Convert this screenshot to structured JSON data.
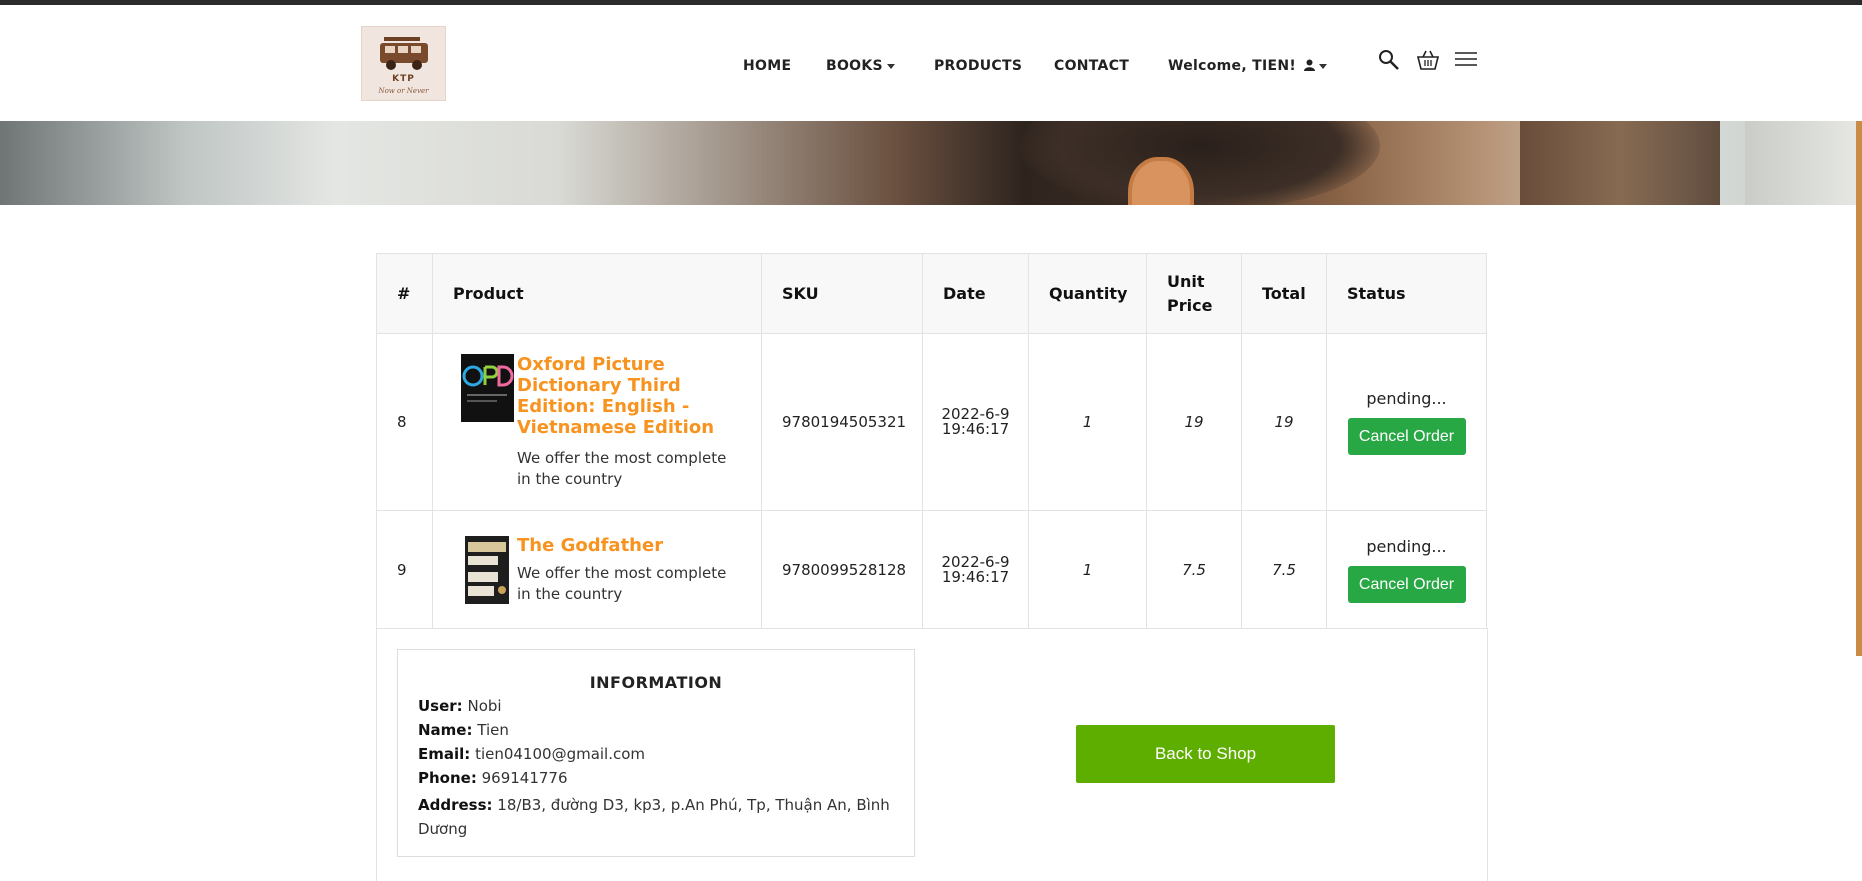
{
  "brand": {
    "logo_title": "KTP",
    "logo_subtitle": "Now or Never"
  },
  "nav": {
    "home": "HOME",
    "books": "BOOKS",
    "products": "PRODUCTS",
    "contact": "CONTACT",
    "welcome": "Welcome, TIEN!",
    "icons": [
      "search-icon",
      "cart-icon",
      "menu-icon"
    ]
  },
  "table": {
    "headers": {
      "num": "#",
      "product": "Product",
      "sku": "SKU",
      "date": "Date",
      "quantity": "Quantity",
      "unit_price": "Unit Price",
      "total": "Total",
      "status": "Status"
    },
    "rows": [
      {
        "num": "8",
        "title": "Oxford Picture Dictionary Third Edition: English - Vietnamese Edition",
        "description": "We offer the most complete in the country",
        "sku": "9780194505321",
        "date": "2022-6-9",
        "time": "19:46:17",
        "quantity": "1",
        "unit_price": "19",
        "total": "19",
        "status": "pending...",
        "action": "Cancel Order"
      },
      {
        "num": "9",
        "title": "The Godfather",
        "description": "We offer the most complete in the country",
        "sku": "9780099528128",
        "date": "2022-6-9",
        "time": "19:46:17",
        "quantity": "1",
        "unit_price": "7.5",
        "total": "7.5",
        "status": "pending...",
        "action": "Cancel Order"
      }
    ]
  },
  "info": {
    "title": "INFORMATION",
    "user_label": "User:",
    "user": "Nobi",
    "name_label": "Name:",
    "name": "Tien",
    "email_label": "Email:",
    "email": "tien04100@gmail.com",
    "phone_label": "Phone:",
    "phone": "969141776",
    "address_label": "Address:",
    "address": "18/B3, đường D3, kp3, p.An Phú, Tp, Thuận An, Bình Dương"
  },
  "back_button": "Back to Shop",
  "colors": {
    "accent": "#f7931e",
    "cancel": "#28a745",
    "back": "#5eae00"
  }
}
